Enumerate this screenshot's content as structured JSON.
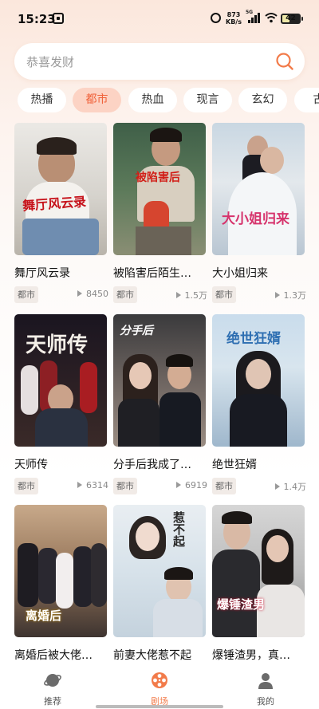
{
  "status": {
    "time": "15:23",
    "net_speed_value": "873",
    "net_speed_unit": "KB/s",
    "net_type": "5G",
    "battery": "42",
    "battery_level": 0.42
  },
  "search": {
    "placeholder": "恭喜发财"
  },
  "tabs": [
    {
      "label": "热播"
    },
    {
      "label": "都市"
    },
    {
      "label": "热血"
    },
    {
      "label": "现言"
    },
    {
      "label": "玄幻"
    },
    {
      "label": "古"
    }
  ],
  "active_tab": "都市",
  "dramas": [
    {
      "title": "舞厅风云录",
      "tag": "都市",
      "plays": "8450",
      "poster_text": "舞厅风云录"
    },
    {
      "title": "被陷害后陌生…",
      "tag": "都市",
      "plays": "1.5万",
      "poster_text": "被陷害后"
    },
    {
      "title": "大小姐归来",
      "tag": "都市",
      "plays": "1.3万",
      "poster_text": "大小姐归来"
    },
    {
      "title": "天师传",
      "tag": "都市",
      "plays": "6314",
      "poster_text": "天师传"
    },
    {
      "title": "分手后我成了…",
      "tag": "都市",
      "plays": "6919",
      "poster_text": "分手后"
    },
    {
      "title": "绝世狂婿",
      "tag": "都市",
      "plays": "1.4万",
      "poster_text": "绝世狂婿"
    },
    {
      "title": "离婚后被大佬…",
      "tag": "都市",
      "plays": "",
      "poster_text": "离婚后"
    },
    {
      "title": "前妻大佬惹不起",
      "tag": "都市",
      "plays": "",
      "poster_text": "惹不起"
    },
    {
      "title": "爆锤渣男，真…",
      "tag": "都市",
      "plays": "",
      "poster_text": "爆锤渣男"
    }
  ],
  "bottom_nav": [
    {
      "label": "推荐",
      "icon": "planet-icon"
    },
    {
      "label": "剧场",
      "icon": "film-reel-icon"
    },
    {
      "label": "我的",
      "icon": "user-icon"
    }
  ],
  "colors": {
    "accent": "#f27b4a",
    "tab_active_bg": "#fcd3c4",
    "tab_active_text": "#f0623a"
  }
}
